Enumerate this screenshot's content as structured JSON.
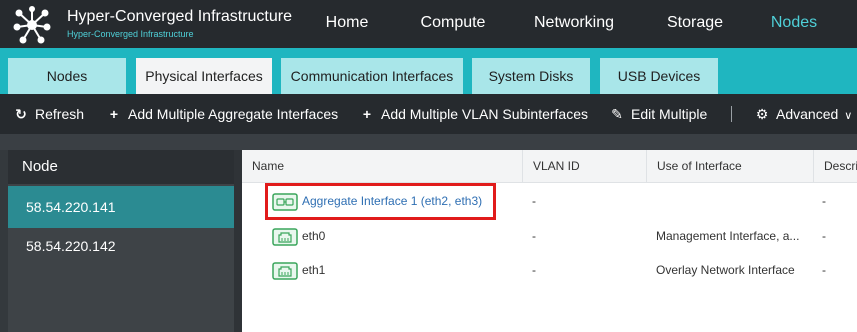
{
  "app": {
    "title": "Hyper-Converged Infrastructure",
    "subtitle": "Hyper-Converged Infrastructure",
    "accent_color": "#1fb6c0"
  },
  "nav": {
    "items": [
      {
        "label": "Home",
        "active": false
      },
      {
        "label": "Compute",
        "active": false
      },
      {
        "label": "Networking",
        "active": false
      },
      {
        "label": "Storage",
        "active": false
      },
      {
        "label": "Nodes",
        "active": true
      }
    ]
  },
  "tabs": [
    {
      "label": "Nodes",
      "active": false
    },
    {
      "label": "Physical Interfaces",
      "active": true
    },
    {
      "label": "Communication Interfaces",
      "active": false
    },
    {
      "label": "System Disks",
      "active": false
    },
    {
      "label": "USB Devices",
      "active": false
    }
  ],
  "toolbar": {
    "refresh": {
      "label": "Refresh",
      "icon": "refresh-icon"
    },
    "add_aggregate": {
      "label": "Add Multiple Aggregate Interfaces",
      "icon": "plus-icon"
    },
    "add_vlan": {
      "label": "Add Multiple VLAN Subinterfaces",
      "icon": "plus-icon"
    },
    "edit_multiple": {
      "label": "Edit Multiple",
      "icon": "pencil-icon"
    },
    "advanced": {
      "label": "Advanced",
      "icon": "gear-icon"
    }
  },
  "node_panel": {
    "header": "Node",
    "items": [
      {
        "label": "58.54.220.141",
        "active": true
      },
      {
        "label": "58.54.220.142",
        "active": false
      }
    ]
  },
  "table": {
    "columns": [
      "Name",
      "VLAN ID",
      "Use of Interface",
      "Descri"
    ],
    "rows": [
      {
        "name": "Aggregate Interface 1 (eth2, eth3)",
        "vlan": "-",
        "use": "",
        "desc": "-",
        "icon": "aggregate-interface-icon",
        "link": true,
        "highlighted": true
      },
      {
        "name": "eth0",
        "vlan": "-",
        "use": "Management Interface, a...",
        "desc": "-",
        "icon": "ethernet-port-icon",
        "link": false,
        "highlighted": false
      },
      {
        "name": "eth1",
        "vlan": "-",
        "use": "Overlay Network Interface",
        "desc": "-",
        "icon": "ethernet-port-icon",
        "link": false,
        "highlighted": false
      }
    ]
  }
}
